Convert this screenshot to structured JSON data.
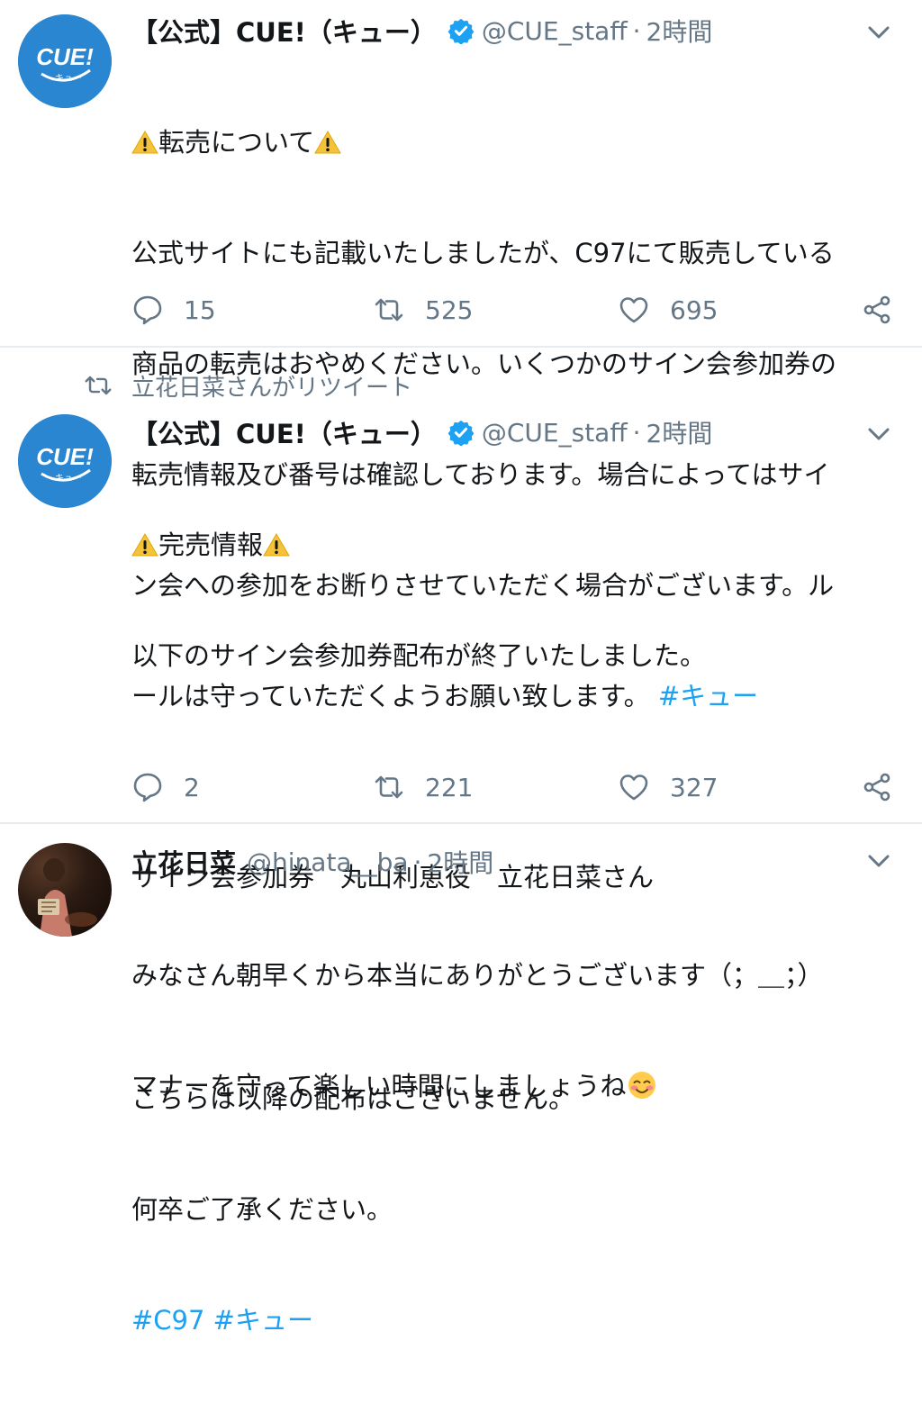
{
  "tweets": [
    {
      "author_name": "【公式】CUE!（キュー）",
      "handle": "@CUE_staff",
      "dot": "·",
      "time": "2時間",
      "avatar_text": "CUE!",
      "avatar_sub": "キュー",
      "title": "転売について",
      "lines": [
        "公式サイトにも記載いたしましたが、C97にて販売している",
        "商品の転売はおやめください。いくつかのサイン会参加券の",
        "転売情報及び番号は確認しております。場合によってはサイ",
        "ン会への参加をお断りさせていただく場合がございます。ル",
        "ールは守っていただくようお願い致します。"
      ],
      "inline_hashtag": "#キュー",
      "replies": "15",
      "retweets": "525",
      "likes": "695"
    },
    {
      "retweeted_by": "立花日菜さんがリツイート",
      "author_name": "【公式】CUE!（キュー）",
      "handle": "@CUE_staff",
      "dot": "·",
      "time": "2時間",
      "avatar_text": "CUE!",
      "avatar_sub": "キュー",
      "title": "完売情報",
      "lines": [
        "以下のサイン会参加券配布が終了いたしました。",
        "",
        "サイン会参加券　丸山利恵役　立花日菜さん",
        "",
        "こちらは以降の配布はございません。",
        "何卒ご了承ください。"
      ],
      "hashtags": "#C97 #キュー",
      "replies": "2",
      "retweets": "221",
      "likes": "327"
    },
    {
      "author_name": "立花日菜",
      "handle": "@hinata__ba",
      "dot": "·",
      "time": "2時間",
      "lines": [
        "みなさん朝早くから本当にありがとうございます（；＿；）",
        "マナーを守って楽しい時間にしましょうね"
      ]
    }
  ],
  "icons": {
    "reply": "reply-icon",
    "retweet": "retweet-icon",
    "like": "heart-icon",
    "share": "share-icon",
    "verified": "verified-badge-icon",
    "more": "chevron-down-icon",
    "warning": "warning-emoji-icon",
    "blush": "smiling-blush-emoji-icon"
  },
  "colors": {
    "link": "#1da1f2",
    "muted": "#657786",
    "text": "#14171a",
    "avatar_blue": "#2a86d1",
    "divider": "#e6ecf0"
  }
}
